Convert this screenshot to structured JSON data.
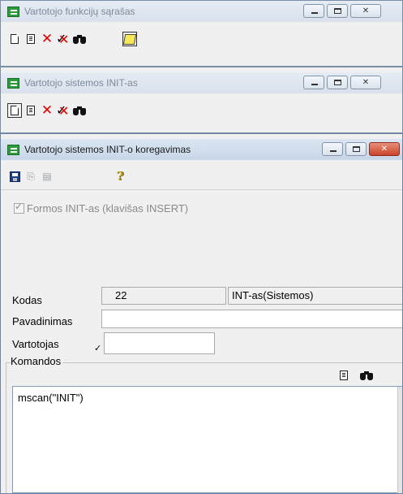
{
  "windows": {
    "functions_list": {
      "title": "Vartotojo funkcijų sąrašas",
      "toolbar": [
        "new-document-icon",
        "document-icon",
        "delete-icon",
        "delete-check-icon",
        "binoculars-icon",
        "note-icon"
      ]
    },
    "init_list": {
      "title": "Vartotojo sistemos INIT-as",
      "toolbar": [
        "new-document-icon",
        "document-icon",
        "delete-icon",
        "delete-check-icon",
        "binoculars-icon"
      ]
    },
    "init_edit": {
      "title": "Vartotojo sistemos INIT-o koregavimas",
      "toolbar": [
        "save-icon",
        "copy-disabled-icon",
        "paste-disabled-icon",
        "help-icon"
      ],
      "checkbox_label": "Formos INIT-as (klavišas INSERT)",
      "checkbox_checked": true,
      "fields": {
        "kodas_label": "Kodas",
        "kodas_value": "22",
        "kodas_desc": "INT-as(Sistemos)",
        "pavadinimas_label": "Pavadinimas",
        "pavadinimas_value": "",
        "vartotojas_label": "Vartotojas",
        "vartotojas_value": ""
      },
      "commands_group": "Komandos",
      "commands_text": "mscan(\"INIT\")"
    }
  },
  "colors": {
    "accent_icon": "#2c9b3a",
    "delete_red": "#e00000",
    "close_red": "#c9452b"
  }
}
